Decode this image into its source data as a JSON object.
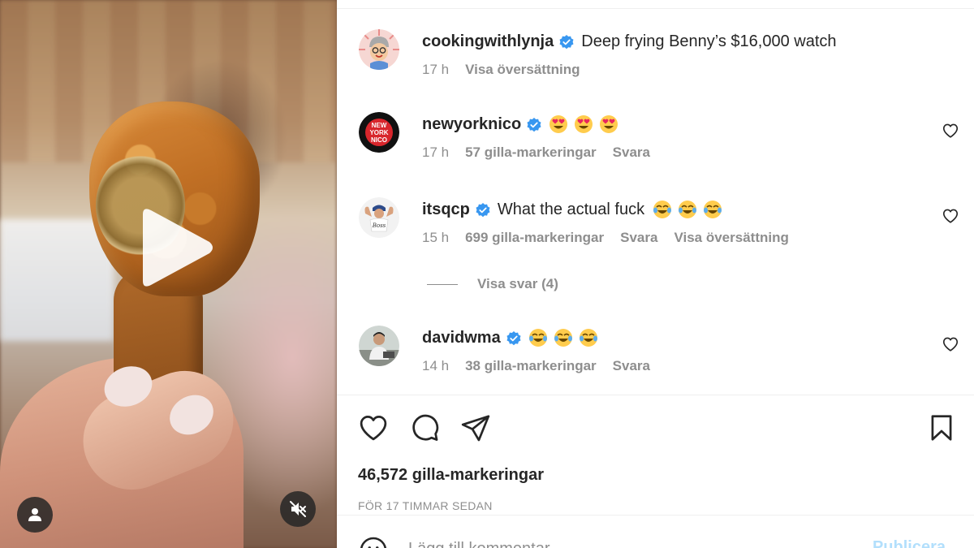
{
  "media": {
    "play_icon": "play-icon",
    "user_icon": "user-icon",
    "mute_icon": "muted-speaker-icon"
  },
  "caption": {
    "username": "cookingwithlynja",
    "text": "Deep frying Benny’s $16,000 watch",
    "time": "17 h",
    "translate": "Visa översättning"
  },
  "comments": [
    {
      "username": "newyorknico",
      "text": "",
      "emojis": [
        "heart-eyes-emoji",
        "heart-eyes-emoji",
        "heart-eyes-emoji"
      ],
      "time": "17 h",
      "likes": "57 gilla-markeringar",
      "reply": "Svara",
      "avatar_text": [
        "NEW",
        "YORK",
        "NICO"
      ]
    },
    {
      "username": "itsqcp",
      "text": "What the actual fuck",
      "emojis": [
        "tears-of-joy-emoji",
        "tears-of-joy-emoji",
        "tears-of-joy-emoji"
      ],
      "time": "15 h",
      "likes": "699 gilla-markeringar",
      "reply": "Svara",
      "translate": "Visa översättning",
      "view_replies": "Visa svar (4)"
    },
    {
      "username": "davidwma",
      "text": "",
      "emojis": [
        "tears-of-joy-emoji",
        "tears-of-joy-emoji",
        "tears-of-joy-emoji"
      ],
      "time": "14 h",
      "likes": "38 gilla-markeringar",
      "reply": "Svara"
    }
  ],
  "actions": {
    "like_icon": "heart-icon",
    "comment_icon": "comment-icon",
    "share_icon": "paper-plane-icon",
    "save_icon": "bookmark-icon"
  },
  "post": {
    "likes": "46,572 gilla-markeringar",
    "posted": "FÖR 17 TIMMAR SEDAN"
  },
  "add_comment": {
    "placeholder": "Lägg till kommentar…",
    "publish": "Publicera"
  },
  "colors": {
    "verified": "#3897f0",
    "text": "#262626",
    "secondary": "#8e8e8e",
    "publish_disabled": "#b2dffc"
  }
}
